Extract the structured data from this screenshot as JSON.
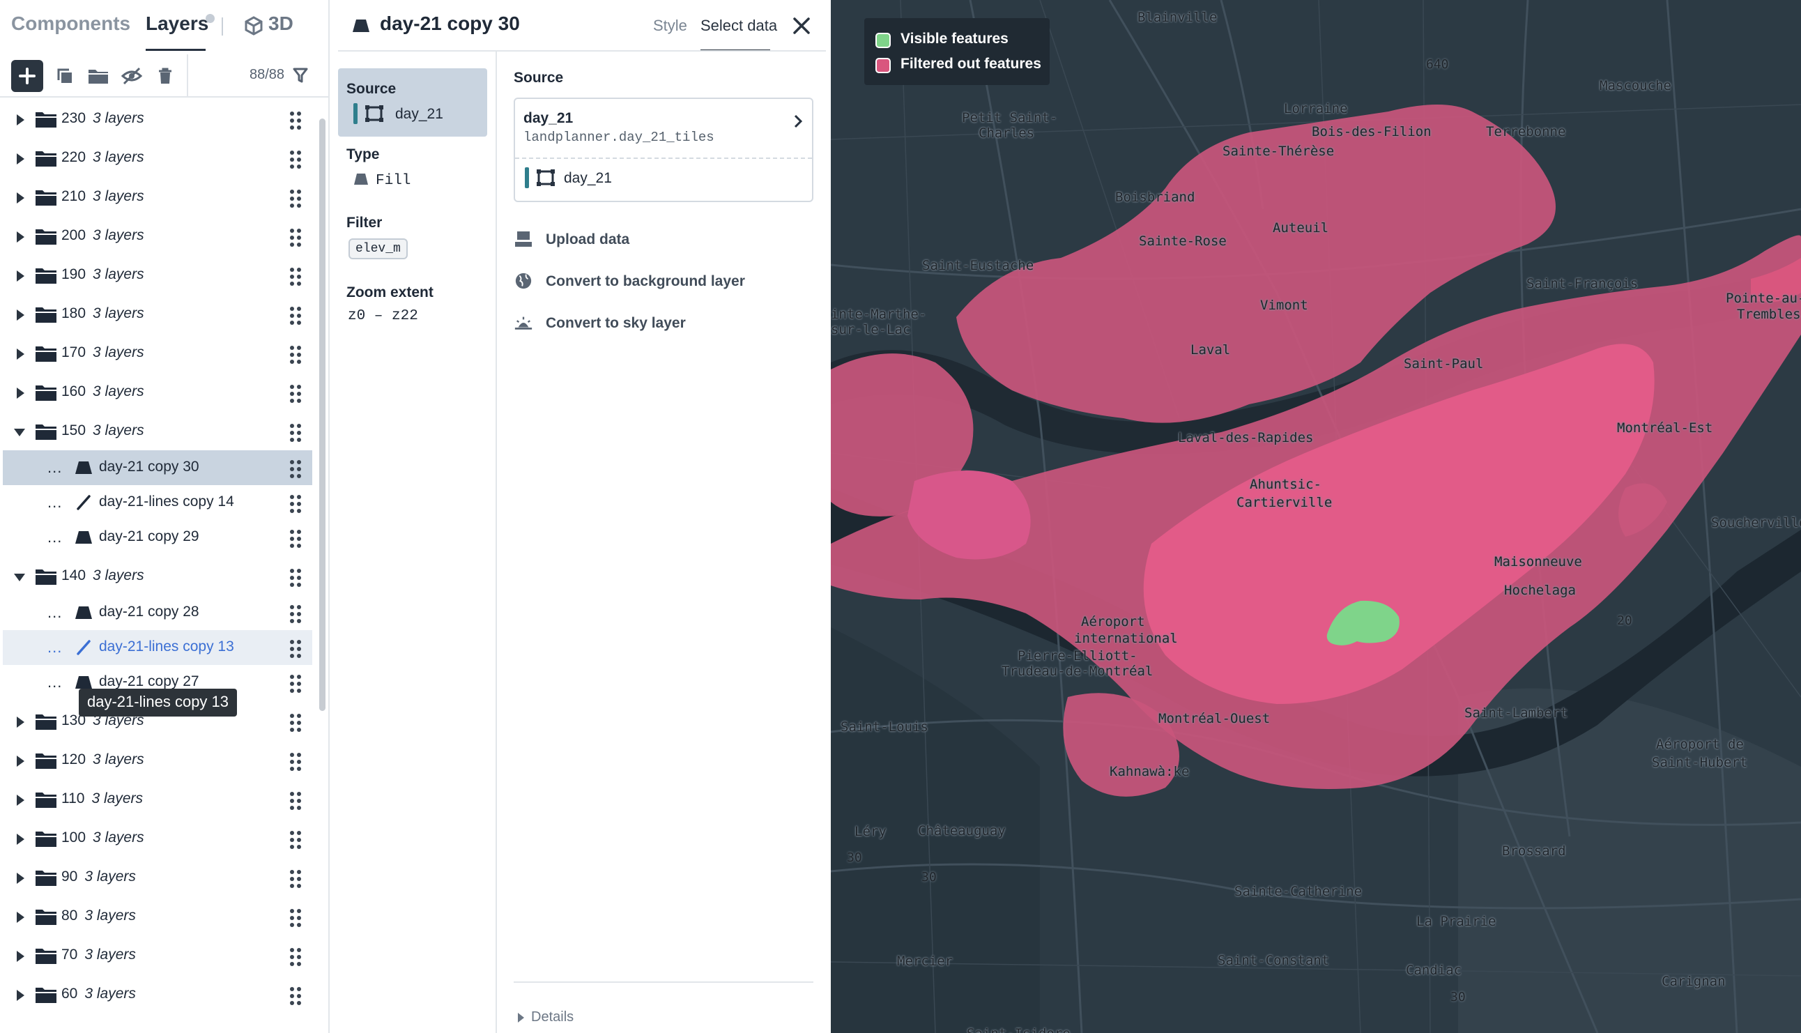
{
  "tabs": {
    "components": "Components",
    "layers": "Layers",
    "three_d": "3D"
  },
  "toolbar": {
    "layer_count": "88/88",
    "icons": [
      "add-layer-icon",
      "duplicate-icon",
      "folder-icon",
      "hide-icon",
      "trash-icon",
      "filter-icon"
    ]
  },
  "layers": {
    "groups_top": [
      {
        "name": "230",
        "count": "3 layers"
      },
      {
        "name": "220",
        "count": "3 layers"
      },
      {
        "name": "210",
        "count": "3 layers"
      },
      {
        "name": "200",
        "count": "3 layers"
      },
      {
        "name": "190",
        "count": "3 layers"
      },
      {
        "name": "180",
        "count": "3 layers"
      },
      {
        "name": "170",
        "count": "3 layers"
      },
      {
        "name": "160",
        "count": "3 layers"
      }
    ],
    "group_150": {
      "name": "150",
      "count": "3 layers",
      "children": [
        {
          "name": "day-21 copy 30",
          "kind": "fill",
          "state": "selected"
        },
        {
          "name": "day-21-lines copy 14",
          "kind": "line"
        },
        {
          "name": "day-21 copy 29",
          "kind": "fill"
        }
      ]
    },
    "group_140": {
      "name": "140",
      "count": "3 layers",
      "children": [
        {
          "name": "day-21 copy 28",
          "kind": "fill"
        },
        {
          "name": "day-21-lines copy 13",
          "kind": "line",
          "state": "hover"
        },
        {
          "name": "day-21 copy 27",
          "kind": "fill"
        }
      ]
    },
    "groups_bottom": [
      {
        "name": "130",
        "count": "3 layers"
      },
      {
        "name": "120",
        "count": "3 layers"
      },
      {
        "name": "110",
        "count": "3 layers"
      },
      {
        "name": "100",
        "count": "3 layers"
      },
      {
        "name": "90",
        "count": "3 layers"
      },
      {
        "name": "80",
        "count": "3 layers"
      },
      {
        "name": "70",
        "count": "3 layers"
      },
      {
        "name": "60",
        "count": "3 layers"
      }
    ],
    "ellipsis": "...",
    "tooltip": "day-21-lines copy 13"
  },
  "panel": {
    "title": "day-21 copy 30",
    "tab_style": "Style",
    "tab_select_data": "Select data",
    "nav": {
      "source_label": "Source",
      "source_value": "day_21",
      "type_label": "Type",
      "type_value": "Fill",
      "filter_label": "Filter",
      "filter_value": "elev_m",
      "zoom_label": "Zoom extent",
      "zoom_value": "z0 – z22"
    },
    "source": {
      "heading": "Source",
      "tileset_name": "day_21",
      "tileset_id": "landplanner.day_21_tiles",
      "layer": "day_21"
    },
    "actions": [
      {
        "label": "Upload data",
        "icon": "upload-icon"
      },
      {
        "label": "Convert to background layer",
        "icon": "globe-icon"
      },
      {
        "label": "Convert to sky layer",
        "icon": "sky-icon"
      }
    ],
    "details": "Details"
  },
  "map": {
    "legend": {
      "visible": {
        "label": "Visible features",
        "color": "#7fd48a"
      },
      "filtered": {
        "label": "Filtered out features",
        "color": "#d9567e"
      }
    },
    "place_labels": [
      "Blainville",
      "Lorraine",
      "Bois-des-Filion",
      "Terrebonne",
      "Mascouche",
      "Petit Saint-",
      "Charles",
      "Sainte-Thérèse",
      "Boisbriand",
      "Auteuil",
      "Sainte-Rose",
      "Saint-Eustache",
      "Vimont",
      "Saint-François",
      "Pointe-au-",
      "Trembles",
      "inte-Marthe-",
      "sur-le-Lac",
      "Laval",
      "Saint-Paul",
      "Laval-des-Rapides",
      "Montréal-Est",
      "Ahuntsic-",
      "Cartierville",
      "Soucherville",
      "Maisonneuve",
      "Hochelaga",
      "Aéroport",
      "international",
      "Pierre-Elliott-",
      "Trudeau-de-Montréal",
      "Montréal-Ouest",
      "Saint-Lambert",
      "Aéroport de",
      "Saint-Hubert",
      "Saint-Louis",
      "Kahnawà:ke",
      "Léry",
      "Châteauguay",
      "Brossard",
      "Sainte-Catherine",
      "La Prairie",
      "Mercier",
      "Saint-Constant",
      "Candiac",
      "Carignan",
      "Saint-Isidore"
    ],
    "road_numbers": [
      "640",
      "30",
      "30",
      "30",
      "20"
    ]
  }
}
